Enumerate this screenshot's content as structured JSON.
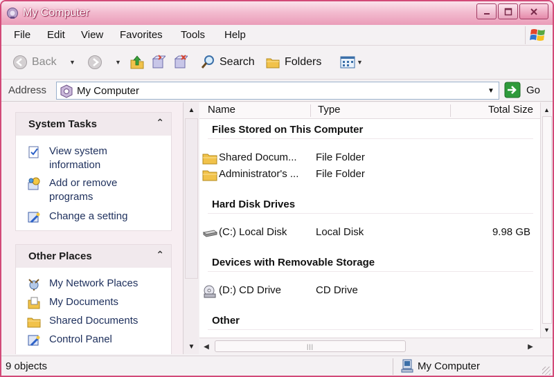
{
  "window": {
    "title": "My Computer"
  },
  "menu": [
    "File",
    "Edit",
    "View",
    "Favorites",
    "Tools",
    "Help"
  ],
  "toolbar": {
    "back_label": "Back",
    "search_label": "Search",
    "folders_label": "Folders"
  },
  "address": {
    "label": "Address",
    "value": "My Computer",
    "go_label": "Go"
  },
  "taskpane": {
    "system_tasks": {
      "title": "System Tasks",
      "items": [
        "View system information",
        "Add or remove programs",
        "Change a setting"
      ]
    },
    "other_places": {
      "title": "Other Places",
      "items": [
        "My Network Places",
        "My Documents",
        "Shared Documents",
        "Control Panel"
      ]
    }
  },
  "list": {
    "columns": [
      "Name",
      "Type",
      "Total Size"
    ],
    "groups": [
      {
        "title": "Files Stored on This Computer",
        "rows": [
          {
            "name": "Shared Docum...",
            "type": "File Folder",
            "size": ""
          },
          {
            "name": "Administrator's ...",
            "type": "File Folder",
            "size": ""
          }
        ]
      },
      {
        "title": "Hard Disk Drives",
        "rows": [
          {
            "name": "(C:) Local Disk",
            "type": "Local Disk",
            "size": "9.98 GB"
          }
        ]
      },
      {
        "title": "Devices with Removable Storage",
        "rows": [
          {
            "name": "(D:) CD Drive",
            "type": "CD Drive",
            "size": ""
          }
        ]
      },
      {
        "title": "Other",
        "rows": []
      }
    ]
  },
  "status": {
    "count": "9 objects",
    "location": "My Computer"
  },
  "icons": {
    "title": "my-computer-icon",
    "back": "back-arrow-icon",
    "forward": "forward-arrow-icon",
    "up": "up-folder-icon",
    "search": "search-icon",
    "folders": "folders-icon",
    "views": "views-icon",
    "go": "go-arrow-icon"
  },
  "colors": {
    "title_bar": "#ea9cb8",
    "frame": "#d24a78",
    "go_green": "#2e9a3a"
  }
}
